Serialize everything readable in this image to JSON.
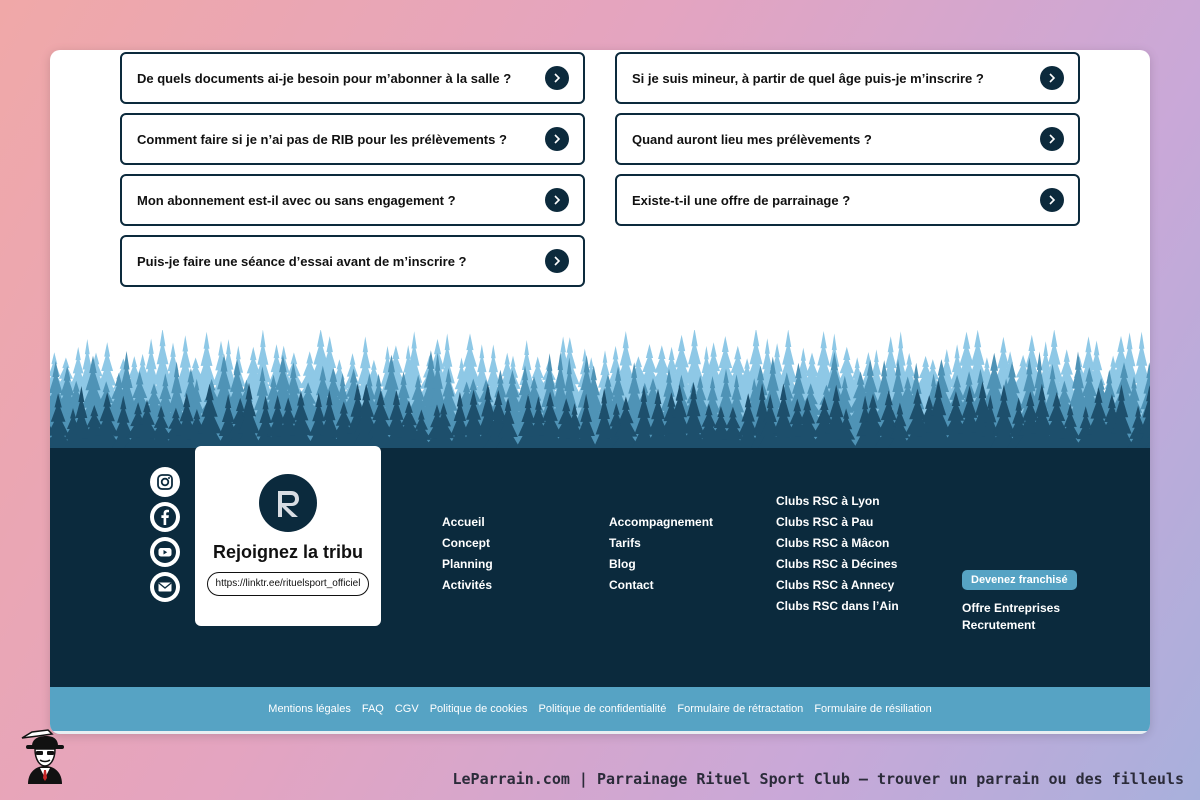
{
  "faq": {
    "left": [
      {
        "question": "De quels documents ai-je besoin pour m’abonner à la salle ?"
      },
      {
        "question": "Comment faire si je n’ai pas de RIB pour les prélèvements ?"
      },
      {
        "question": "Mon abonnement est-il avec ou sans engagement ?"
      },
      {
        "question": "Puis-je faire une séance d’essai avant de m’inscrire ?"
      }
    ],
    "right": [
      {
        "question": "Si je suis mineur, à partir de quel âge puis-je m’inscrire ?"
      },
      {
        "question": "Quand auront lieu mes prélèvements ?"
      },
      {
        "question": "Existe-t-il une offre de parrainage ?"
      }
    ]
  },
  "footer": {
    "tribu": {
      "title": "Rejoignez la tribu",
      "link": "https://linktr.ee/rituelsport_officiel"
    },
    "nav1": [
      "Accueil",
      "Concept",
      "Planning",
      "Activités"
    ],
    "nav2": [
      "Accompagnement",
      "Tarifs",
      "Blog",
      "Contact"
    ],
    "clubs": [
      "Clubs RSC à Lyon",
      "Clubs RSC à Pau",
      "Clubs RSC à Mâcon",
      "Clubs RSC à Décines",
      "Clubs RSC à Annecy",
      "Clubs RSC dans l’Ain"
    ],
    "franchise_label": "Devenez franchisé",
    "extra": [
      "Offre Entreprises",
      "Recrutement"
    ],
    "legal": [
      "Mentions légales",
      "FAQ",
      "CGV",
      "Politique de cookies",
      "Politique de confidentialité",
      "Formulaire de rétractation",
      "Formulaire de résiliation"
    ]
  },
  "caption": "LeParrain.com | Parrainage Rituel Sport Club — trouver un parrain ou des filleuls",
  "colors": {
    "navy": "#0b2a3d",
    "accent": "#56a3c4",
    "tree_light": "#8ec8e6",
    "tree_mid": "#4f93b6",
    "tree_dark": "#1d4f6c"
  },
  "icons": [
    "instagram-icon",
    "facebook-icon",
    "youtube-icon",
    "mail-icon",
    "chevron-right-icon",
    "rsc-logo",
    "mascot-icon"
  ]
}
